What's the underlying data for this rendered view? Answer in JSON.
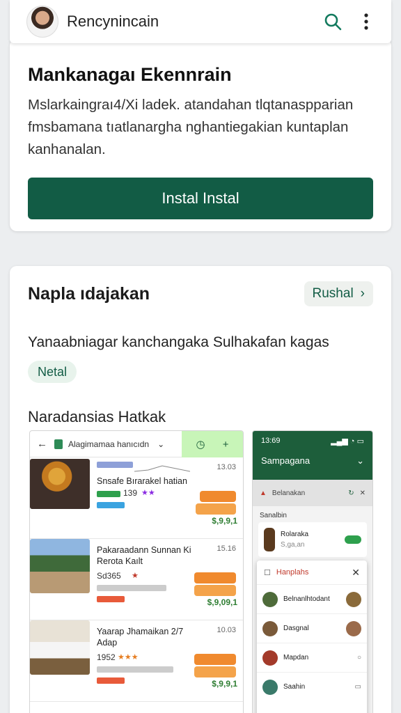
{
  "header": {
    "app_name": "Rencynincain",
    "icons": [
      "avatar",
      "search-icon",
      "more-vert-icon"
    ]
  },
  "hero": {
    "title": "Mankanagaı Ekennrain",
    "description": "Mslarkaingraı4/Xi ladek. atandahan tlqtanaspparian fmsbamana tıatlanargha nghantiegakian kuntaplan kanhanalan.",
    "install_label": "Instal Instal"
  },
  "details": {
    "title": "Napla ıdajakan",
    "action_label": "Rushal",
    "subtitle": "Yanaabniagar kanchangaka Sulhakafan kagas",
    "tag": "Netal",
    "section_label": "Naradansias Hatkak"
  },
  "screenshot_a": {
    "header_text": "Alagimamaa hanıcıdn",
    "rows": [
      {
        "name": "Snsafe Bırarakel hatian",
        "date": "13.03",
        "rating": "139",
        "price": "$,9,9,1"
      },
      {
        "name": "Pakaraadann Sunnan Ki Rerota Kaılt",
        "date": "15.16",
        "rating": "Sd365",
        "price": "$,9,09,1"
      },
      {
        "name": "Yaarap Jhamaikan 2/7 Adap",
        "date": "10.03",
        "rating": "1952",
        "price": "$,9,9,1"
      }
    ]
  },
  "screenshot_b": {
    "time": "13:69",
    "title": "Sampagana",
    "filter": "Belanakan",
    "list_label": "Sanalbin",
    "item": {
      "name": "Rolaraka",
      "sub": "S,ga,an"
    },
    "popup_title": "Hanplahs",
    "popup_rows": [
      "Belnanlhtodant",
      "Dasgnal",
      "Mapdan",
      "Saahin"
    ]
  },
  "colors": {
    "primary": "#125c45",
    "accent_orange": "#f08a2e",
    "price_green": "#2e7d32"
  }
}
